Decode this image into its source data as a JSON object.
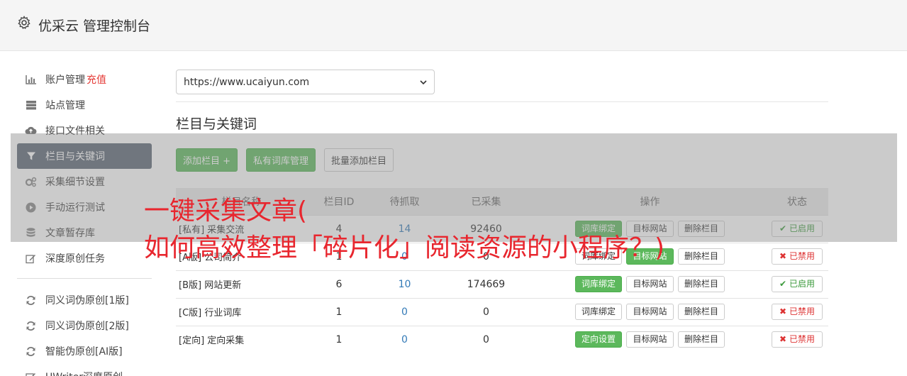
{
  "header": {
    "title": "优采云 管理控制台",
    "icon": "gear-icon"
  },
  "sidebar": {
    "items": [
      {
        "label": "账户管理",
        "extra": "充值",
        "icon": "bar-chart-icon"
      },
      {
        "label": "站点管理",
        "icon": "server-icon"
      },
      {
        "label": "接口文件相关",
        "icon": "cloud-upload-icon"
      },
      {
        "label": "栏目与关键词",
        "icon": "filter-icon",
        "active": true
      },
      {
        "label": "采集细节设置",
        "icon": "cogs-icon"
      },
      {
        "label": "手动运行测试",
        "icon": "play-circle-icon"
      },
      {
        "label": "文章暂存库",
        "icon": "database-icon"
      },
      {
        "label": "深度原创任务",
        "icon": "edit-icon"
      }
    ],
    "items2": [
      {
        "label": "同义词伪原创[1版]",
        "icon": "refresh-icon"
      },
      {
        "label": "同义词伪原创[2版]",
        "icon": "refresh-icon"
      },
      {
        "label": "智能伪原创[AI版]",
        "icon": "refresh-icon"
      },
      {
        "label": "UWriter深度原创",
        "icon": "edit-icon"
      }
    ]
  },
  "main": {
    "site_select": "https://www.ucaiyun.com",
    "section_title": "栏目与关键词",
    "buttons": {
      "add_column": "添加栏目 +",
      "private_lib": "私有词库管理",
      "batch_add": "批量添加栏目"
    },
    "table": {
      "headers": [
        "栏目名称",
        "栏目ID",
        "待抓取",
        "已采集",
        "操作",
        "状态"
      ],
      "rows": [
        {
          "name": "[私有] 采集交流",
          "id": "4",
          "pending": "14",
          "collected": "92460",
          "op1": "词库绑定",
          "op2": "目标网站",
          "op3": "删除栏目",
          "status": "已启用"
        },
        {
          "name": "[A版] 公司简介",
          "id": "1",
          "pending": "0",
          "collected": "0",
          "op1": "词库绑定",
          "op2": "目标网站",
          "op3": "删除栏目",
          "status": "已禁用"
        },
        {
          "name": "[B版] 网站更新",
          "id": "6",
          "pending": "10",
          "collected": "174669",
          "op1": "词库绑定",
          "op2": "目标网站",
          "op3": "删除栏目",
          "status": "已启用"
        },
        {
          "name": "[C版] 行业词库",
          "id": "1",
          "pending": "0",
          "collected": "0",
          "op1": "词库绑定",
          "op2": "目标网站",
          "op3": "删除栏目",
          "status": "已禁用"
        },
        {
          "name": "[定向] 定向采集",
          "id": "1",
          "pending": "0",
          "collected": "0",
          "op1": "定向设置",
          "op2": "目标网站",
          "op3": "删除栏目",
          "status": "已禁用"
        }
      ]
    }
  },
  "overlay": {
    "line1": "一键采集文章(",
    "line2": "如何高效整理「碎片化」阅读资源的小程序？)"
  },
  "colors": {
    "accent_green": "#5cb85c",
    "sidebar_active": "#5a6473",
    "overlay_text": "#e8262e"
  }
}
